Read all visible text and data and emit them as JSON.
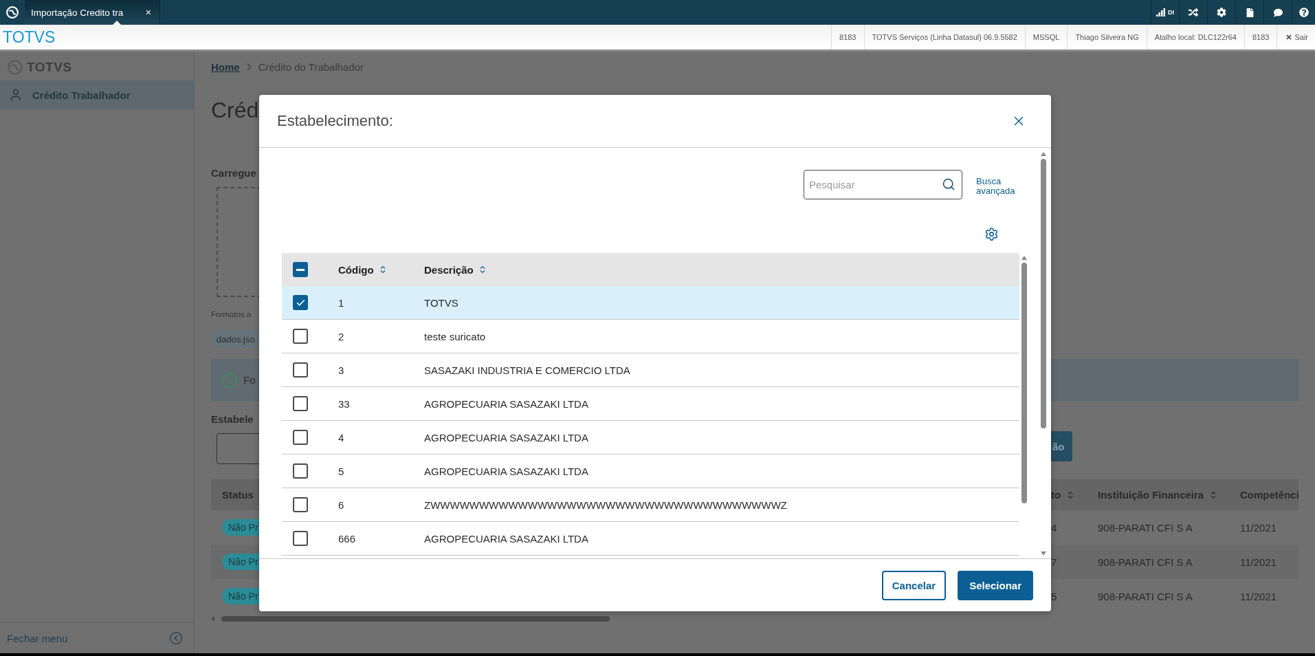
{
  "top_bar": {
    "tab": {
      "label": "Importação Credito tra",
      "close": "×",
      "selected": true
    },
    "signal_label": "DI"
  },
  "header": {
    "brand": "TOTVS",
    "info": [
      "8183",
      "TOTVS Serviços (Linha Datasul) 06.9.5582",
      "MSSQL",
      "Thiago Silveira NG",
      "Atalho local: DLC122r64",
      "8183"
    ],
    "logout": "Sair"
  },
  "sidebar": {
    "logo": "TOTVS",
    "items": [
      {
        "label": "Crédito Trabalhador",
        "selected": true
      }
    ],
    "collapse": "Fechar menu"
  },
  "page": {
    "breadcrumb": [
      {
        "label": "Home",
        "kind": "link"
      },
      {
        "label": "Crédito do Trabalhador",
        "kind": "current"
      }
    ],
    "title": "Créd",
    "upload_label": "Carregue",
    "formats_note": "Formatos a",
    "file_chip": "dados.jso",
    "info_text": "Fo",
    "field_label": "Estabele",
    "action_button": "ão",
    "table": {
      "columns": [
        {
          "label": "Status"
        },
        {
          "label": "to",
          "sortable": true
        },
        {
          "label": "Instituição Financeira",
          "sortable": true
        },
        {
          "label": "Competênci"
        }
      ],
      "rows": [
        {
          "status": "Não Pr",
          "column_2": "4",
          "institution": "908-PARATI CFI S A",
          "competence": "11/2021"
        },
        {
          "status": "Não Pr",
          "column_2": "7",
          "institution": "908-PARATI CFI S A",
          "competence": "11/2021"
        },
        {
          "status": "Não Pr",
          "column_2": "5",
          "institution": "908-PARATI CFI S A",
          "competence": "11/2021"
        }
      ]
    }
  },
  "dialog": {
    "title": "Estabelecimento:",
    "search": {
      "placeholder": "Pesquisar"
    },
    "advanced_search": "Busca avançada",
    "select_all": {
      "indeterminate": true
    },
    "columns": [
      {
        "label": "Código",
        "sortable": true
      },
      {
        "label": "Descrição",
        "sortable": true
      }
    ],
    "rows": [
      {
        "code": "1",
        "description": "TOTVS",
        "selected": true
      },
      {
        "code": "2",
        "description": "teste suricato",
        "selected": false
      },
      {
        "code": "3",
        "description": "SASAZAKI INDUSTRIA E COMERCIO LTDA",
        "selected": false
      },
      {
        "code": "33",
        "description": "AGROPECUARIA SASAZAKI LTDA",
        "selected": false
      },
      {
        "code": "4",
        "description": "AGROPECUARIA SASAZAKI LTDA",
        "selected": false
      },
      {
        "code": "5",
        "description": "AGROPECUARIA SASAZAKI LTDA",
        "selected": false
      },
      {
        "code": "6",
        "description": "ZWWWWWWWWWWWWWWWWWWWWWWWWWWWWWWWWWWWWZ",
        "selected": false
      },
      {
        "code": "666",
        "description": "AGROPECUARIA SASAZAKI LTDA",
        "selected": false
      }
    ],
    "buttons": [
      {
        "label": "Cancelar",
        "kind": "secondary"
      },
      {
        "label": "Selecionar",
        "kind": "primary"
      }
    ]
  }
}
